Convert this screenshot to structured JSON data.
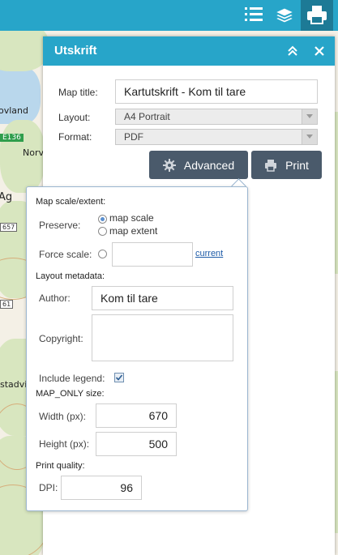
{
  "topbar": {
    "icons": [
      "list-icon",
      "layers-icon",
      "print-icon"
    ]
  },
  "map": {
    "place_labels": [
      "ovland",
      "Norv",
      "Ag",
      "stadvik"
    ],
    "road_label": "E136",
    "number_labels": [
      "657",
      "61"
    ]
  },
  "panel": {
    "title": "Utskrift",
    "map_title_label": "Map title:",
    "map_title_value": "Kartutskrift - Kom til tare",
    "layout_label": "Layout:",
    "layout_value": "A4 Portrait",
    "format_label": "Format:",
    "format_value": "PDF",
    "advanced_label": "Advanced",
    "print_label": "Print"
  },
  "advanced": {
    "scale_section": "Map scale/extent:",
    "preserve_label": "Preserve:",
    "opt_map_scale": "map scale",
    "opt_map_extent": "map extent",
    "preserve_selected": "map scale",
    "force_scale_label": "Force scale:",
    "force_scale_value": "",
    "current_link": "current",
    "metadata_section": "Layout metadata:",
    "author_label": "Author:",
    "author_value": "Kom til tare",
    "copyright_label": "Copyright:",
    "copyright_value": "",
    "include_legend_label": "Include legend:",
    "include_legend_checked": true,
    "maponly_section": "MAP_ONLY size:",
    "width_label": "Width (px):",
    "width_value": "670",
    "height_label": "Height (px):",
    "height_value": "500",
    "quality_section": "Print quality:",
    "dpi_label": "DPI:",
    "dpi_value": "96"
  },
  "colors": {
    "header": "#27a5c9",
    "header_active": "#1d7a96",
    "button": "#4a5a6b",
    "link": "#1f5ca8"
  }
}
